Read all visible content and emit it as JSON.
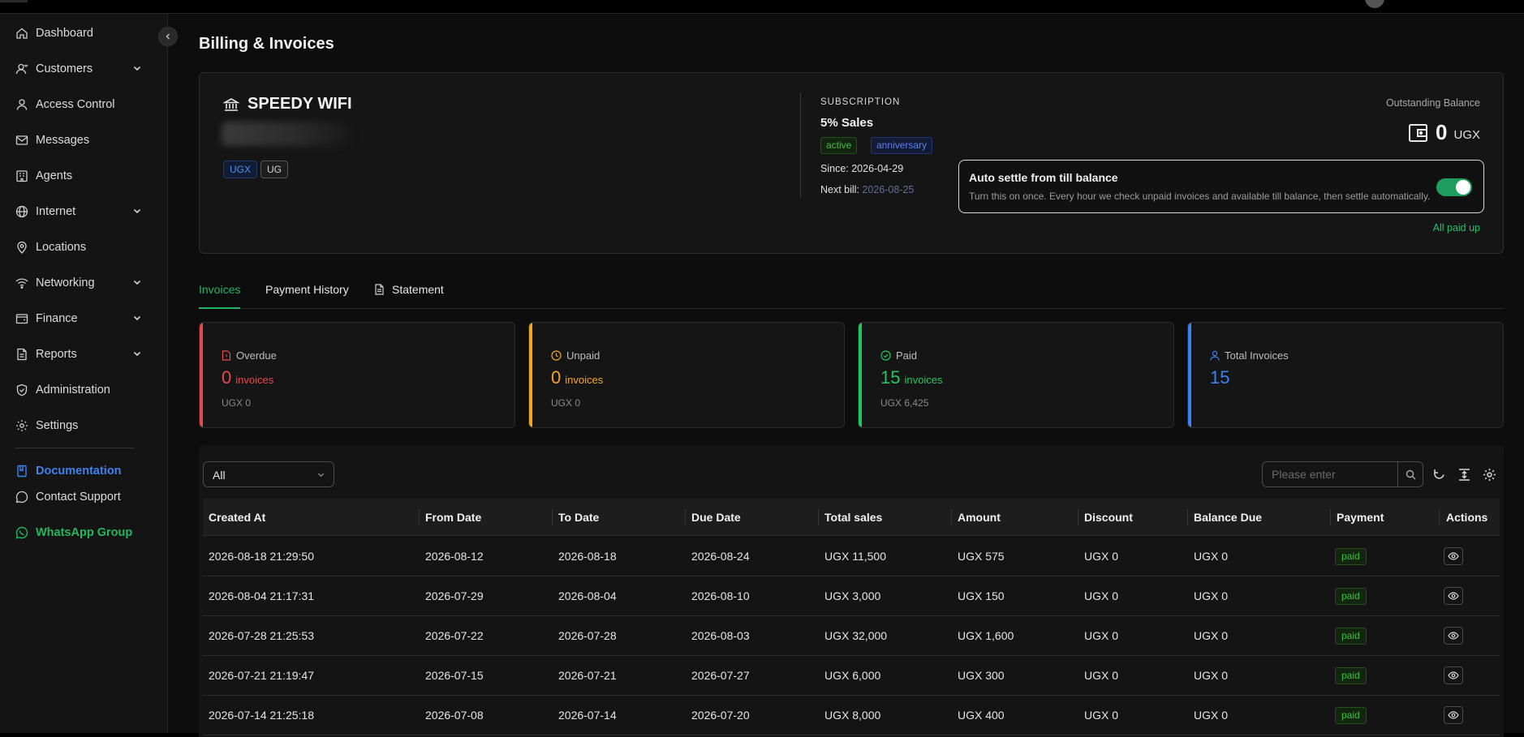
{
  "sidebar": {
    "items": [
      {
        "label": "Dashboard",
        "icon": "home-icon"
      },
      {
        "label": "Customers",
        "icon": "user-icon"
      },
      {
        "label": "Access Control",
        "icon": "person-icon"
      },
      {
        "label": "Messages",
        "icon": "mail-icon"
      },
      {
        "label": "Agents",
        "icon": "building-icon"
      },
      {
        "label": "Internet",
        "icon": "globe-icon"
      },
      {
        "label": "Locations",
        "icon": "pin-icon"
      },
      {
        "label": "Networking",
        "icon": "wifi-icon"
      },
      {
        "label": "Finance",
        "icon": "wallet-icon"
      },
      {
        "label": "Reports",
        "icon": "report-icon"
      },
      {
        "label": "Administration",
        "icon": "shield-icon"
      },
      {
        "label": "Settings",
        "icon": "gear-icon"
      }
    ],
    "documentation": "Documentation",
    "contact": "Contact Support",
    "whatsapp": "WhatsApp Group"
  },
  "page": {
    "title": "Billing & Invoices"
  },
  "summary": {
    "brand": "SPEEDY WIFI",
    "tags": [
      "UGX",
      "UG"
    ],
    "subscription_label": "SUBSCRIPTION",
    "plan": "5% Sales",
    "badges": [
      "active",
      "anniversary"
    ],
    "since_label": "Since:",
    "since": "2026-04-29",
    "next_bill_label": "Next bill:",
    "next_bill": "2026-08-25",
    "outstanding_label": "Outstanding Balance",
    "outstanding_value": "0",
    "outstanding_currency": "UGX",
    "auto_title": "Auto settle from till balance",
    "auto_desc": "Turn this on once. Every hour we check unpaid invoices and available till balance, then settle automatically.",
    "auto_enabled": true,
    "paid_status": "All paid up"
  },
  "tabs": [
    "Invoices",
    "Payment History",
    "Statement"
  ],
  "stats": [
    {
      "label": "Overdue",
      "value": "0",
      "unit": "invoices",
      "amount": "UGX 0",
      "color": "#e5484d"
    },
    {
      "label": "Unpaid",
      "value": "0",
      "unit": "invoices",
      "amount": "UGX 0",
      "color": "#f5a524"
    },
    {
      "label": "Paid",
      "value": "15",
      "unit": "invoices",
      "amount": "UGX 6,425",
      "color": "#22c55e"
    },
    {
      "label": "Total Invoices",
      "value": "15",
      "unit": "",
      "amount": "",
      "color": "#3b82f6"
    }
  ],
  "toolbar": {
    "filter_value": "All",
    "search_placeholder": "Please enter"
  },
  "table": {
    "columns": [
      "Created At",
      "From Date",
      "To Date",
      "Due Date",
      "Total sales",
      "Amount",
      "Discount",
      "Balance Due",
      "Payment",
      "Actions"
    ],
    "rows": [
      [
        "2026-08-18 21:29:50",
        "2026-08-12",
        "2026-08-18",
        "2026-08-24",
        "UGX 11,500",
        "UGX 575",
        "UGX 0",
        "UGX 0",
        "paid"
      ],
      [
        "2026-08-04 21:17:31",
        "2026-07-29",
        "2026-08-04",
        "2026-08-10",
        "UGX 3,000",
        "UGX 150",
        "UGX 0",
        "UGX 0",
        "paid"
      ],
      [
        "2026-07-28 21:25:53",
        "2026-07-22",
        "2026-07-28",
        "2026-08-03",
        "UGX 32,000",
        "UGX 1,600",
        "UGX 0",
        "UGX 0",
        "paid"
      ],
      [
        "2026-07-21 21:19:47",
        "2026-07-15",
        "2026-07-21",
        "2026-07-27",
        "UGX 6,000",
        "UGX 300",
        "UGX 0",
        "UGX 0",
        "paid"
      ],
      [
        "2026-07-14 21:25:18",
        "2026-07-08",
        "2026-07-14",
        "2026-07-20",
        "UGX 8,000",
        "UGX 400",
        "UGX 0",
        "UGX 0",
        "paid"
      ]
    ]
  }
}
